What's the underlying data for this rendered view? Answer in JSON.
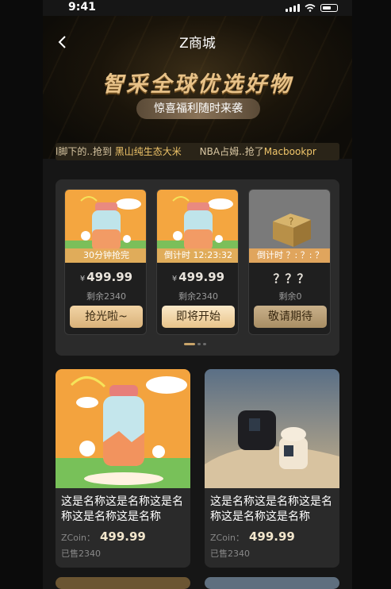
{
  "status": {
    "time": "9:41"
  },
  "header": {
    "back_icon": "chevron-left-icon",
    "title": "Z商城"
  },
  "banner": {
    "headline": "智采全球优选好物",
    "subtitle": "惊喜福利随时来袭"
  },
  "ticker": {
    "prefix1": "l脚下的..抢到 ",
    "item1": "黑山纯生态大米",
    "prefix2": "      NBA占姆..抢了",
    "item2": "Macbookpr"
  },
  "flash_sale": {
    "cards": [
      {
        "status": "30分钟抢完",
        "currency": "¥",
        "price": "499.99",
        "stock": "剩余2340",
        "button": "抢光啦~"
      },
      {
        "status": "倒计时 12:23:32",
        "currency": "¥",
        "price": "499.99",
        "stock": "剩余2340",
        "button": "即将开始"
      },
      {
        "status": "倒计时 ？: ？: ？",
        "currency": "",
        "price": "？？？",
        "stock": "剩余0",
        "button": "敬请期待"
      }
    ]
  },
  "products": [
    {
      "name": "这是名称这是名称这是名称这是名称这是名称",
      "currency_label": "ZCoin：",
      "price": "499.99",
      "sold": "已售2340"
    },
    {
      "name": "这是名称这是名称这是名称这是名称这是名称",
      "currency_label": "ZCoin：",
      "price": "499.99",
      "sold": "已售2340"
    }
  ],
  "colors": {
    "accent_gold": "#e8c288",
    "ticker_highlight": "#f0c56a",
    "page_bg": "#161616"
  }
}
